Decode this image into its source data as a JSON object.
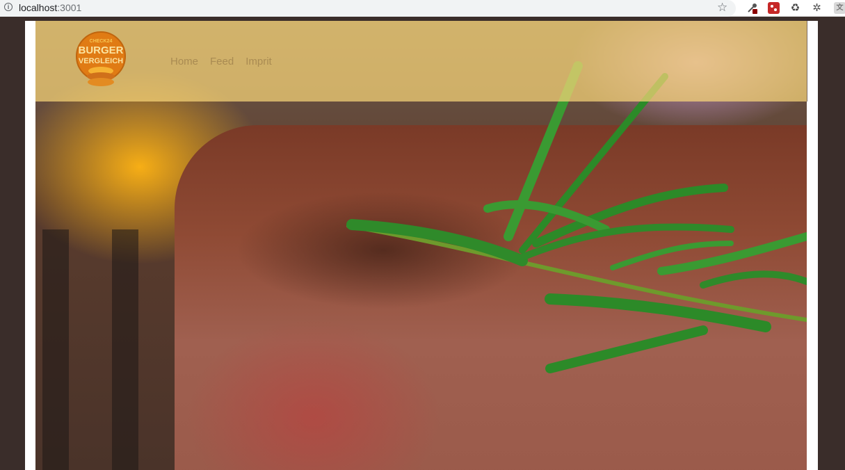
{
  "browser": {
    "url_host": "localhost",
    "url_port": ":3001",
    "info_icon": "info-icon",
    "bookmark_icon": "star-icon",
    "extensions": [
      "eyedropper-icon",
      "extension-red-icon",
      "recycle-icon",
      "bug-icon",
      "translate-icon"
    ]
  },
  "header": {
    "logo": {
      "line1": "CHECK24",
      "line2": "BURGER",
      "line3": "VERGLEICH"
    },
    "nav": [
      {
        "label": "Home"
      },
      {
        "label": "Feed"
      },
      {
        "label": "Imprit"
      }
    ]
  },
  "colors": {
    "page_background": "#3a2d2a",
    "header_overlay": "#f8d678",
    "nav_text": "#a98b52",
    "logo_orange": "#e07b14"
  }
}
